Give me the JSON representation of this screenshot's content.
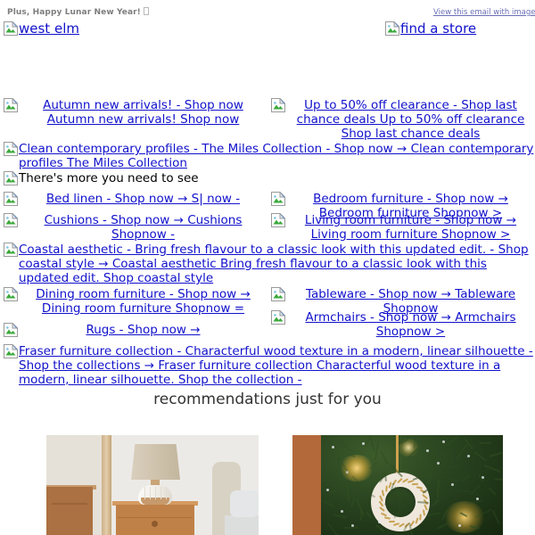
{
  "email": {
    "preheader": "Plus, Happy Lunar New Year!",
    "preheader_glyph": "missing-character-box",
    "view_online_link": "View this email with images",
    "brand_logo_alt": "west elm",
    "find_store_alt": "find a store"
  },
  "blocked_image_icon": "broken-image-icon",
  "hero": [
    {
      "name": "autumn-new-arrivals",
      "alt": "Autumn new arrivals! - Shop now Autumn new arrivals! Shop now"
    },
    {
      "name": "clearance",
      "alt": "Up to 50% off clearance - Shop last chance deals Up to 50% off clearance Shop last chance deals"
    }
  ],
  "miles_collection": {
    "name": "miles-collection",
    "alt": "Clean contemporary profiles - The Miles Collection - Shop now → Clean contemporary profiles The Miles Collection"
  },
  "section_heading": {
    "name": "theres-more",
    "alt": "There's more you need to see"
  },
  "category_grid": [
    {
      "name": "bed-linen",
      "alt": "Bed linen - Shop now → S| now -"
    },
    {
      "name": "bedroom-furniture",
      "alt": "Bedroom furniture - Shop now → Bedroom furniture Shopnow >"
    },
    {
      "name": "cushions",
      "alt": "Cushions - Shop now → Cushions Shopnow -"
    },
    {
      "name": "living-room-furniture",
      "alt": "Living room furniture - Shop now → Living room furniture Shopnow >"
    }
  ],
  "coastal": {
    "name": "coastal-aesthetic",
    "alt": "Coastal aesthetic - Bring fresh flavour to a classic look with this updated edit. - Shop coastal style → Coastal aesthetic Bring fresh flavour to a classic look with this updated edit. Shop coastal style"
  },
  "category_grid_2": [
    {
      "name": "dining-room-furniture",
      "alt": "Dining room furniture - Shop now → Dining room furniture Shopnow ="
    },
    {
      "name": "tableware",
      "alt": "Tableware - Shop now → Tableware Shopnow"
    },
    {
      "name": "rugs",
      "alt": "Rugs - Shop now →"
    },
    {
      "name": "armchairs",
      "alt": "Armchairs - Shop now → Armchairs Shopnow >"
    }
  ],
  "fraser": {
    "name": "fraser-furniture-collection",
    "alt": "Fraser furniture collection - Characterful wood texture in a modern, linear silhouette - Shop the collections → Fraser furniture collection Characterful wood texture in a modern, linear silhouette. Shop the collection -"
  },
  "recommendations": {
    "title": "recommendations just for you",
    "products": [
      {
        "name": "bedside-lamp-scene",
        "description": "ceramic table lamp on wooden nightstand beside bed"
      },
      {
        "name": "holiday-ornament",
        "description": "white beaded wreath ornament hanging on lit christmas tree"
      }
    ]
  },
  "colors": {
    "link": "#1111cc",
    "preheader_text": "#7d7d7d",
    "view_online": "#6a6fb5",
    "heading": "#333333",
    "page_background": "#ffffff"
  }
}
